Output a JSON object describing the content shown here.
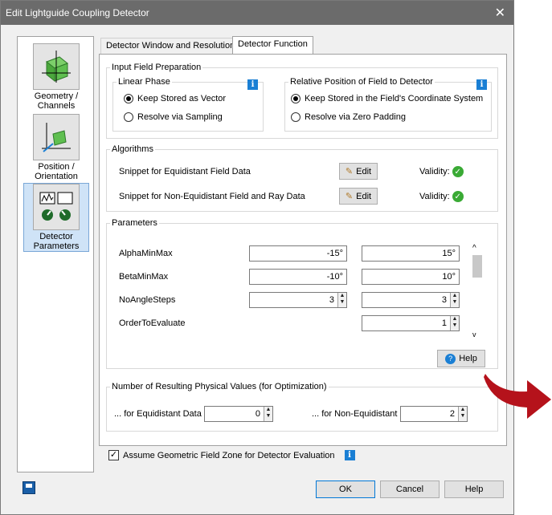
{
  "window": {
    "title": "Edit Lightguide Coupling Detector",
    "close_glyph": "✕"
  },
  "nav": [
    {
      "label": "Geometry / Channels"
    },
    {
      "label": "Position / Orientation"
    },
    {
      "label": "Detector Parameters"
    }
  ],
  "tabs": {
    "resolution": "Detector Window and Resolution",
    "function": "Detector Function"
  },
  "input_field": {
    "legend": "Input Field Preparation",
    "linear_phase": {
      "legend": "Linear Phase",
      "options": [
        "Keep Stored as Vector",
        "Resolve via Sampling"
      ],
      "selected": "Keep Stored as Vector"
    },
    "relative_position": {
      "legend": "Relative Position of Field to Detector",
      "options": [
        "Keep Stored in the Field's Coordinate System",
        "Resolve via Zero Padding"
      ],
      "selected": "Keep Stored in the Field's Coordinate System"
    }
  },
  "algorithms": {
    "legend": "Algorithms",
    "rows": [
      {
        "label": "Snippet for Equidistant Field Data",
        "edit": "Edit",
        "validity": "Validity:"
      },
      {
        "label": "Snippet for Non-Equidistant Field and Ray Data",
        "edit": "Edit",
        "validity": "Validity:"
      }
    ]
  },
  "parameters": {
    "legend": "Parameters",
    "rows": [
      {
        "name": "AlphaMinMax",
        "v1": "-15°",
        "v2": "15°"
      },
      {
        "name": "BetaMinMax",
        "v1": "-10°",
        "v2": "10°"
      },
      {
        "name": "NoAngleSteps",
        "v1": "3",
        "v2": "3"
      },
      {
        "name": "OrderToEvaluate",
        "v1": "",
        "v2": "1"
      }
    ],
    "help": "Help"
  },
  "physical_values": {
    "legend": "Number of Resulting Physical Values (for Optimization)",
    "equidistant_label": "... for Equidistant Data",
    "equidistant_value": "0",
    "non_equidistant_label": "... for Non-Equidistant Data",
    "non_equidistant_value": "2"
  },
  "assume_geometric": {
    "label": "Assume Geometric Field Zone for Detector Evaluation",
    "checked": true
  },
  "footer": {
    "ok": "OK",
    "cancel": "Cancel",
    "help": "Help"
  },
  "colors": {
    "accent": "#1a7fd4",
    "valid": "#3aaa35",
    "arrow": "#b5121b"
  }
}
